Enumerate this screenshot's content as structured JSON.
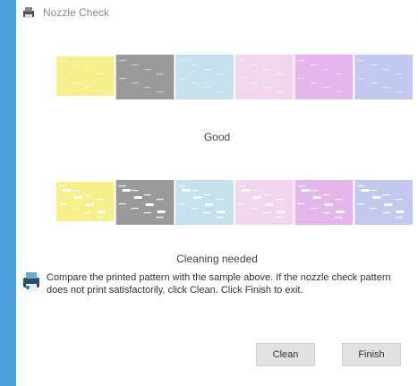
{
  "window": {
    "title": "Nozzle Check",
    "close_glyph": "×"
  },
  "patterns": {
    "colors": [
      "#f5f08a",
      "#9a9a9a",
      "#c6e1ee",
      "#f2d6ee",
      "#e3b6ec",
      "#c4c8ef"
    ],
    "good_label": "Good",
    "cleaning_label": "Cleaning needed"
  },
  "instructions": {
    "icon": "printer-check-icon",
    "text": "Compare the printed pattern with the sample above. If the nozzle check pattern does not print satisfactorily, click Clean. Click Finish to exit."
  },
  "buttons": {
    "clean": "Clean",
    "finish": "Finish"
  }
}
